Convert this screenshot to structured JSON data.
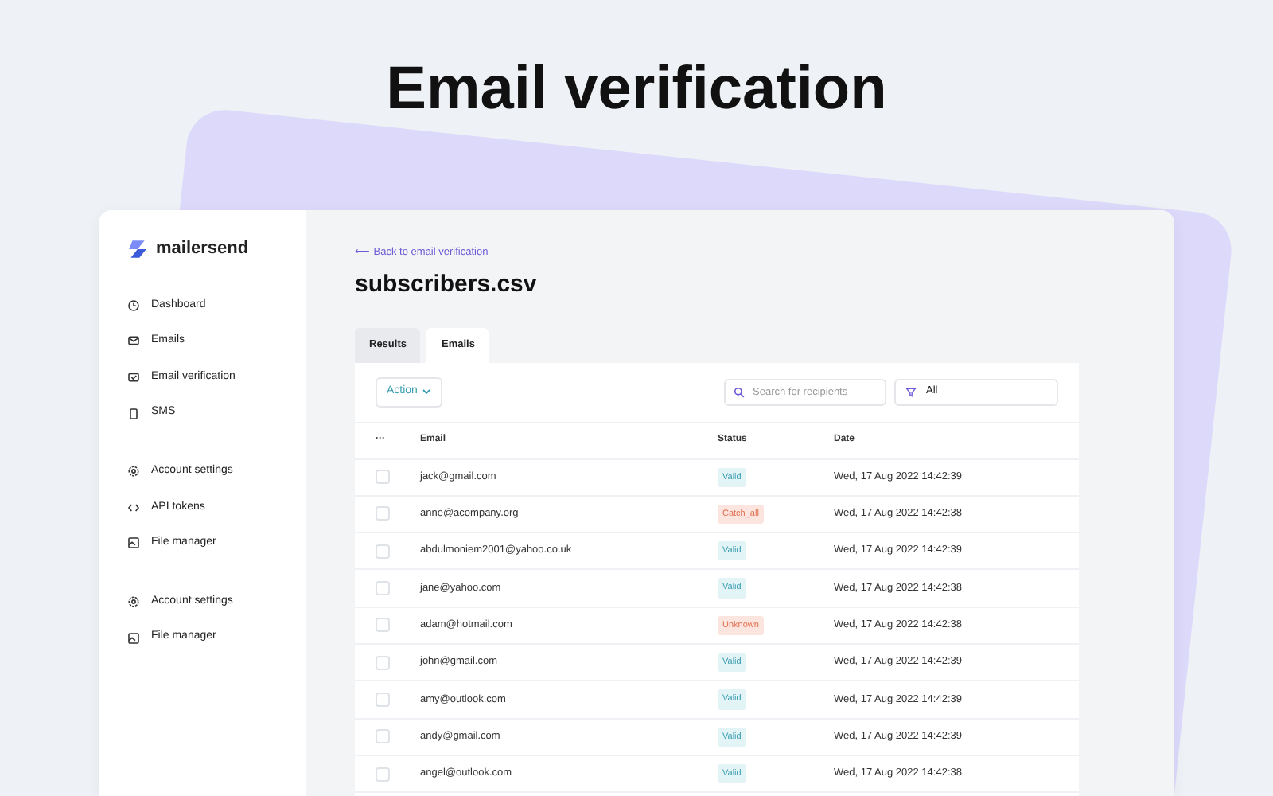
{
  "headline": "Email verification",
  "sidebar": {
    "logo": "mailersend",
    "sections": [
      {
        "items": [
          {
            "label": "Dashboard",
            "kind": "clock"
          },
          {
            "label": "Emails",
            "kind": "mail"
          },
          {
            "label": "Email verification",
            "kind": "verify"
          },
          {
            "label": "SMS",
            "kind": "phone"
          }
        ]
      },
      {
        "items": [
          {
            "label": "Account settings",
            "kind": "settings"
          },
          {
            "label": "API tokens",
            "kind": "code"
          },
          {
            "label": "File manager",
            "kind": "file"
          }
        ]
      },
      {
        "items": [
          {
            "label": "Account settings",
            "kind": "settings"
          },
          {
            "label": "File manager",
            "kind": "file"
          }
        ]
      }
    ]
  },
  "back_link": "⟵ Back to email verification",
  "title": "subscribers.csv",
  "tabs": [
    {
      "label": "Results",
      "selected": false
    },
    {
      "label": "Emails",
      "selected": true
    }
  ],
  "toolbar": {
    "action": "Action",
    "search": {
      "placeholder": "Search for recipients"
    },
    "filter": "All"
  },
  "table": {
    "columns": [
      "···",
      "Email",
      "Status",
      "Date"
    ],
    "rows": [
      {
        "email": "jack@gmail.com",
        "status": "Valid",
        "kind": "valid",
        "date": "Wed, 17 Aug 2022 14:42:39",
        "checked": false
      },
      {
        "email": "anne@acompany.org",
        "status": "Catch_all",
        "kind": "risky",
        "date": "Wed, 17 Aug 2022 14:42:38",
        "checked": false
      },
      {
        "email": "abdulmoniem2001@yahoo.co.uk",
        "status": "Valid",
        "kind": "valid",
        "date": "Wed, 17 Aug 2022 14:42:39",
        "checked": false
      },
      {
        "email": "jane@yahoo.com",
        "status": "Valid",
        "kind": "valid",
        "date": "Wed, 17 Aug 2022 14:42:38",
        "checked": false
      },
      {
        "email": "adam@hotmail.com",
        "status": "Unknown",
        "kind": "risky",
        "date": "Wed, 17 Aug 2022 14:42:38",
        "checked": false
      },
      {
        "email": "john@gmail.com",
        "status": "Valid",
        "kind": "valid",
        "date": "Wed, 17 Aug 2022 14:42:39",
        "checked": false
      },
      {
        "email": "amy@outlook.com",
        "status": "Valid",
        "kind": "valid",
        "date": "Wed, 17 Aug 2022 14:42:39",
        "checked": false
      },
      {
        "email": "andy@gmail.com",
        "status": "Valid",
        "kind": "valid",
        "date": "Wed, 17 Aug 2022 14:42:39",
        "checked": false
      },
      {
        "email": "angel@outlook.com",
        "status": "Valid",
        "kind": "valid",
        "date": "Wed, 17 Aug 2022 14:42:38",
        "checked": false
      }
    ]
  }
}
